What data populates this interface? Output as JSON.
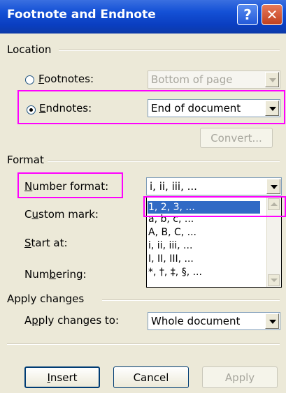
{
  "dialog": {
    "title": "Footnote and Endnote",
    "help_label": "?",
    "close_label": "✕"
  },
  "location": {
    "group_label": "Location",
    "footnotes_label": "Footnotes:",
    "footnotes_mnemonic": "F",
    "footnotes_rest": "ootnotes:",
    "footnotes_value": "Bottom of page",
    "endnotes_label": "Endnotes:",
    "endnotes_mnemonic": "E",
    "endnotes_rest": "ndnotes:",
    "endnotes_value": "End of document",
    "selected": "endnotes",
    "convert_label": "Convert..."
  },
  "format": {
    "group_label": "Format",
    "number_format_label": "Number format:",
    "number_format_mnemonic": "N",
    "number_format_rest": "umber format:",
    "number_format_value": "i, ii, iii, ...",
    "custom_mark_prefix": "C",
    "custom_mark_mnemonic": "u",
    "custom_mark_rest": "stom mark:",
    "start_at_mnemonic": "S",
    "start_at_rest": "tart at:",
    "numbering_prefix": "Num",
    "numbering_mnemonic": "b",
    "numbering_rest": "ering:",
    "dropdown_options": [
      "1, 2, 3, ...",
      "a, b, c, ...",
      "A, B, C, ...",
      "i, ii, iii, ...",
      "I, II, III, ...",
      "*, †, ‡, §, ..."
    ],
    "highlighted_option": "1, 2, 3, ..."
  },
  "apply_changes": {
    "group_label": "Apply changes",
    "apply_to_prefix": "A",
    "apply_to_mnemonic": "p",
    "apply_to_rest": "ply changes to:",
    "apply_to_value": "Whole document"
  },
  "buttons": {
    "insert_mnemonic": "I",
    "insert_rest": "nsert",
    "cancel_label": "Cancel",
    "apply_label": "Apply"
  },
  "colors": {
    "titlebar": "#0a3ec0",
    "face": "#ece9d8",
    "highlight_box": "#ff00ff",
    "selection": "#316ac5"
  }
}
